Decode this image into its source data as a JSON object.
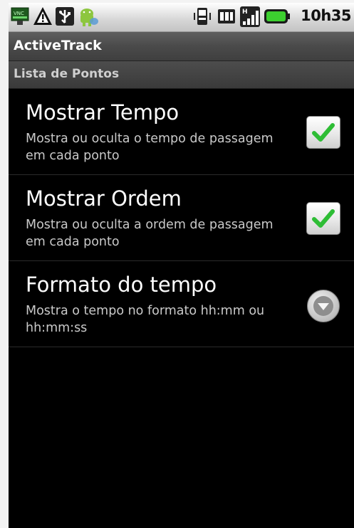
{
  "status_bar": {
    "time": "10h35",
    "icons": [
      "vnc-icon",
      "warning-icon",
      "usb-icon",
      "android-debug-icon",
      "vibrate-icon",
      "sd-card-icon",
      "signal-icon",
      "battery-icon"
    ]
  },
  "app": {
    "title": "ActiveTrack"
  },
  "category": {
    "label": "Lista de Pontos"
  },
  "preferences": [
    {
      "title": "Mostrar Tempo",
      "summary": "Mostra ou oculta o tempo de passagem em cada ponto",
      "control": "checkbox",
      "checked": true
    },
    {
      "title": "Mostrar Ordem",
      "summary": "Mostra ou oculta a ordem de passagem em cada ponto",
      "control": "checkbox",
      "checked": true
    },
    {
      "title": "Formato do tempo",
      "summary": "Mostra o tempo no formato hh:mm ou hh:mm:ss",
      "control": "dropdown"
    }
  ],
  "colors": {
    "check_green": "#2ebd35",
    "background": "#000000"
  }
}
